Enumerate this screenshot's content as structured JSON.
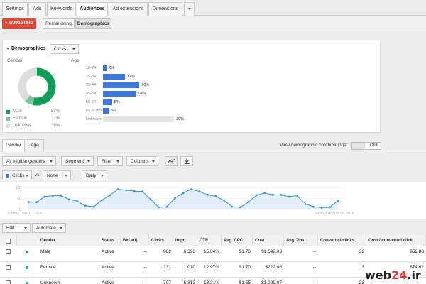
{
  "top_tabs": [
    "Settings",
    "Ads",
    "Keywords",
    "Audiences",
    "Ad extensions",
    "Dimensions"
  ],
  "targeting_button": "+ TARGETING",
  "view_segments": [
    "Remarketing",
    "Demographics"
  ],
  "demographics": {
    "title": "Demographics",
    "metric_dropdown": "Clicks",
    "gender_label": "Gender",
    "age_label": "Age",
    "gender_legend": [
      {
        "name": "Male",
        "pct": "53%",
        "color": "#0f9d58"
      },
      {
        "name": "Female",
        "pct": "7%",
        "color": "#7cc29a"
      },
      {
        "name": "Unknown",
        "pct": "39%",
        "color": "#dddddd"
      }
    ],
    "gender_values": [
      53,
      7,
      39
    ],
    "age_groups": [
      {
        "label": "18-24",
        "pct": "2%",
        "value": 2
      },
      {
        "label": "25-34",
        "pct": "12%",
        "value": 12
      },
      {
        "label": "35-44",
        "pct": "20%",
        "value": 20
      },
      {
        "label": "45-54",
        "pct": "18%",
        "value": 18
      },
      {
        "label": "55-64",
        "pct": "5%",
        "value": 5
      },
      {
        "label": "65 or more",
        "pct": "3%",
        "value": 3
      },
      {
        "label": "Unknown",
        "pct": "39%",
        "value": 39
      }
    ]
  },
  "lower_tabs": [
    "Gender",
    "Age"
  ],
  "combinations_label": "View demographic combinations:",
  "toggle_state": "OFF",
  "filters": {
    "all_genders": "All eligible genders",
    "segment": "Segment",
    "filter": "Filter",
    "columns": "Columns",
    "metric1": "Clicks",
    "vs": "vs",
    "metric2": "None",
    "period": "Daily"
  },
  "chart_data": {
    "type": "area",
    "y_ticks": [
      "120",
      "60",
      "0"
    ],
    "ylim": [
      0,
      120
    ],
    "start_label": "Sunday, July 31, 2016",
    "end_label": "Sunday, August 28, 2016",
    "values": [
      40,
      40,
      70,
      75,
      75,
      55,
      45,
      20,
      15,
      50,
      78,
      110,
      105,
      100,
      98,
      55,
      12,
      15,
      62,
      90,
      110,
      98,
      80,
      72,
      50,
      15,
      12,
      40,
      78,
      90,
      80,
      80,
      70,
      75,
      30,
      15,
      10,
      12,
      48
    ]
  },
  "table_actions": {
    "edit": "Edit",
    "automate": "Automate"
  },
  "table": {
    "headers": [
      "Gender",
      "Status",
      "Bid adj.",
      "Clicks",
      "Impr.",
      "CTR",
      "Avg. CPC",
      "Cost",
      "Avg. Pos.",
      "Converted clicks",
      "Cost / converted click"
    ],
    "rows": [
      [
        "Male",
        "Active",
        "--",
        "962",
        "6,398",
        "15.04%",
        "$1.76",
        "$1,692.03",
        "--",
        "32",
        "$52.88"
      ],
      [
        "Female",
        "Active",
        "--",
        "131",
        "1,010",
        "12.97%",
        "$1.70",
        "$222.06",
        "--",
        "3",
        "$74.02"
      ],
      [
        "Unknown",
        "Active",
        "--",
        "707",
        "5,313",
        "13.31%",
        "$1.55",
        "$1,099.07",
        "--",
        "23",
        ""
      ]
    ]
  },
  "watermark": {
    "prefix": "web",
    "digits": "24",
    "suffix": ".ir"
  },
  "colors": {
    "accent": "#dd4b39",
    "bar": "#3c78d8",
    "male": "#0f9d58"
  }
}
